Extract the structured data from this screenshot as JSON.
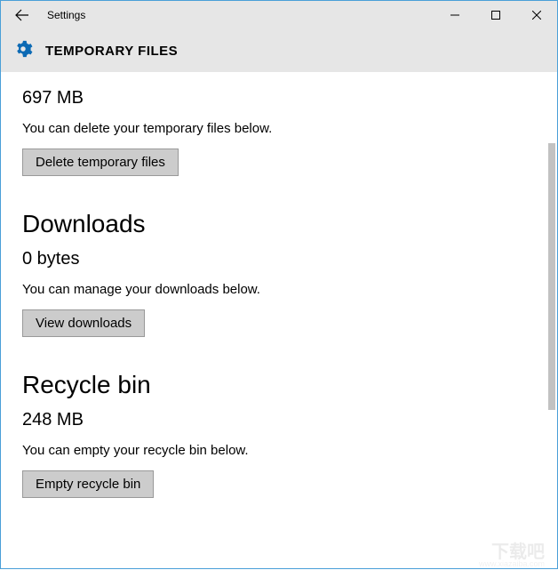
{
  "window": {
    "title": "Settings"
  },
  "header": {
    "title": "TEMPORARY FILES"
  },
  "sections": {
    "temporary": {
      "size": "697 MB",
      "description": "You can delete your temporary files below.",
      "button": "Delete temporary files"
    },
    "downloads": {
      "heading": "Downloads",
      "size": "0 bytes",
      "description": "You can manage your downloads below.",
      "button": "View downloads"
    },
    "recycle": {
      "heading": "Recycle bin",
      "size": "248 MB",
      "description": "You can empty your recycle bin below.",
      "button": "Empty recycle bin"
    }
  },
  "watermark": {
    "main": "下载吧",
    "sub": "www.xiazaiba.com"
  }
}
